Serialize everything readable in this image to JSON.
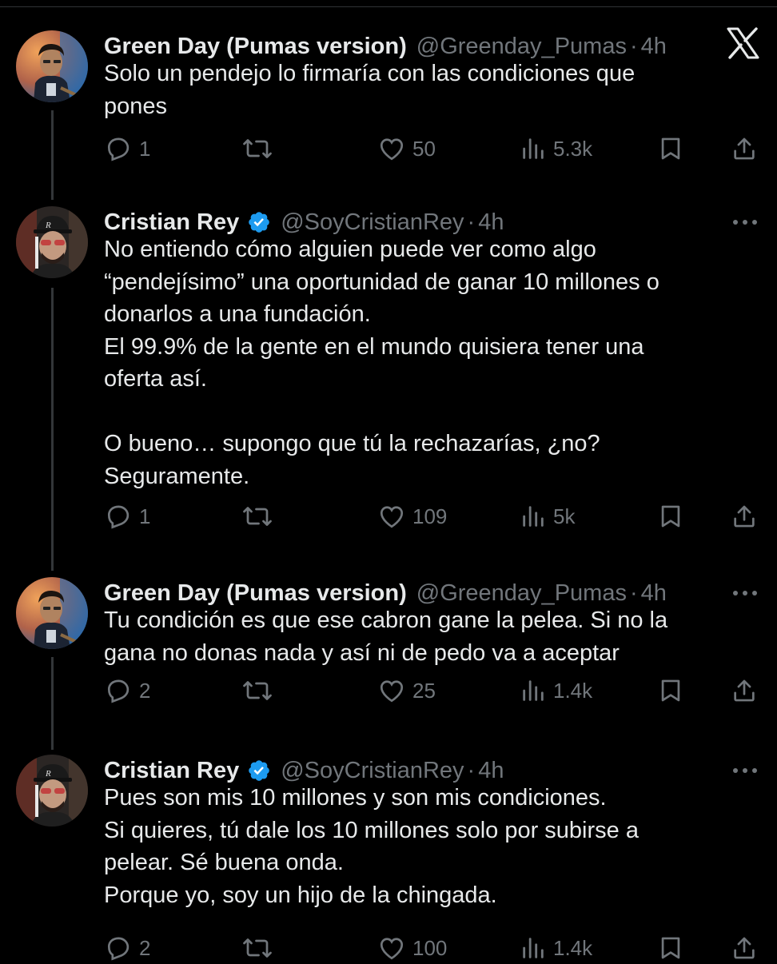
{
  "app": {
    "logo": "x-logo"
  },
  "tweets": [
    {
      "name": "Green Day (Pumas version)",
      "handle": "@Greenday_Pumas",
      "separator": "·",
      "time": "4h",
      "verified": false,
      "body": [
        "Solo un pendejo lo firmaría con las condiciones que",
        "pones"
      ],
      "replies": "1",
      "retweets": "",
      "likes": "50",
      "views": "5.3k"
    },
    {
      "name": "Cristian Rey",
      "handle": "@SoyCristianRey",
      "separator": "·",
      "time": "4h",
      "verified": true,
      "body": [
        "No entiendo cómo alguien puede ver como algo",
        "“pendejísimo” una oportunidad de ganar 10 millones o",
        "donarlos a una fundación.",
        "El 99.9% de la gente en el mundo quisiera tener una",
        "oferta así.",
        "",
        "O bueno… supongo que tú la rechazarías, ¿no?",
        "Seguramente."
      ],
      "replies": "1",
      "retweets": "",
      "likes": "109",
      "views": "5k"
    },
    {
      "name": "Green Day (Pumas version)",
      "handle": "@Greenday_Pumas",
      "separator": "·",
      "time": "4h",
      "verified": false,
      "body": [
        "Tu condición es que ese cabron gane la pelea. Si no la",
        "gana no donas nada y así ni de pedo va a aceptar"
      ],
      "replies": "2",
      "retweets": "",
      "likes": "25",
      "views": "1.4k"
    },
    {
      "name": "Cristian Rey",
      "handle": "@SoyCristianRey",
      "separator": "·",
      "time": "4h",
      "verified": true,
      "body": [
        "Pues son mis 10 millones y son mis condiciones.",
        "Si quieres, tú dale los 10 millones solo por subirse a",
        "pelear. Sé buena onda.",
        "Porque yo, soy un hijo de la chingada."
      ],
      "replies": "2",
      "retweets": "",
      "likes": "100",
      "views": "1.4k"
    }
  ],
  "colors": {
    "background": "#000000",
    "text": "#e7e9ea",
    "muted": "#71767b",
    "verified": "#1d9bf0",
    "thread_line": "#333639"
  },
  "icons": [
    "reply-icon",
    "retweet-icon",
    "like-icon",
    "views-icon",
    "bookmark-icon",
    "share-icon",
    "more-icon",
    "verified-badge-icon"
  ]
}
